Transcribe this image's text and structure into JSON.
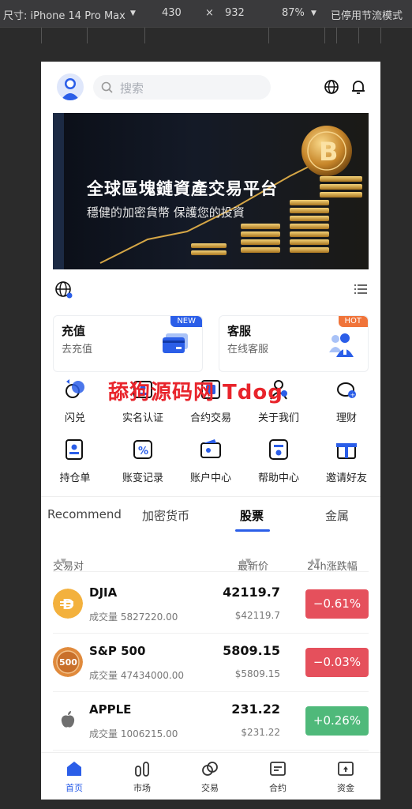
{
  "devtools": {
    "device_label": "尺寸: iPhone 14 Pro Max",
    "width": "430",
    "times": "×",
    "height": "932",
    "zoom": "87%",
    "throttle": "已停用节流模式"
  },
  "header": {
    "search_placeholder": "搜索",
    "icons": [
      "avatar-icon",
      "search-icon",
      "globe-icon",
      "bell-icon"
    ]
  },
  "banner": {
    "title": "全球區塊鏈資產交易平台",
    "subtitle": "穩健的加密貨幣 保護您的投資"
  },
  "cards": [
    {
      "title": "充值",
      "subtitle": "去充值",
      "badge": "NEW",
      "badge_color": "#2b5ee8"
    },
    {
      "title": "客服",
      "subtitle": "在线客服",
      "badge": "HOT",
      "badge_color": "#f0743a"
    }
  ],
  "watermark": "舔狗源码网 Tdog",
  "grid": [
    {
      "label": "闪兑",
      "icon": "exchange-icon"
    },
    {
      "label": "实名认证",
      "icon": "id-verify-icon"
    },
    {
      "label": "合约交易",
      "icon": "contract-icon"
    },
    {
      "label": "关于我们",
      "icon": "about-icon"
    },
    {
      "label": "理财",
      "icon": "piggy-bank-icon"
    },
    {
      "label": "持仓单",
      "icon": "holdings-icon"
    },
    {
      "label": "账变记录",
      "icon": "record-icon"
    },
    {
      "label": "账户中心",
      "icon": "wallet-icon"
    },
    {
      "label": "帮助中心",
      "icon": "help-icon"
    },
    {
      "label": "邀请好友",
      "icon": "gift-icon"
    }
  ],
  "tabs": [
    "Recommend",
    "加密货币",
    "股票",
    "金属"
  ],
  "active_tab": "股票",
  "table": {
    "headers": {
      "pair": "交易对",
      "price": "最新价",
      "change": "24h涨跌幅"
    },
    "rows": [
      {
        "name": "DJIA",
        "volume": "成交量 5827220.00",
        "price": "42119.7",
        "price_usd": "$42119.7",
        "change": "−0.61%",
        "direction": "down"
      },
      {
        "name": "S&P 500",
        "volume": "成交量 47434000.00",
        "price": "5809.15",
        "price_usd": "$5809.15",
        "change": "−0.03%",
        "direction": "down"
      },
      {
        "name": "APPLE",
        "volume": "成交量 1006215.00",
        "price": "231.22",
        "price_usd": "$231.22",
        "change": "+0.26%",
        "direction": "up"
      }
    ]
  },
  "bottom_nav": [
    {
      "label": "首页",
      "icon": "home-icon",
      "active": true
    },
    {
      "label": "市场",
      "icon": "market-icon",
      "active": false
    },
    {
      "label": "交易",
      "icon": "trade-icon",
      "active": false
    },
    {
      "label": "合约",
      "icon": "contract-nav-icon",
      "active": false
    },
    {
      "label": "资金",
      "icon": "assets-icon",
      "active": false
    }
  ],
  "colors": {
    "accent": "#2b5ee8",
    "down": "#e5505c",
    "up": "#4fb97a"
  }
}
